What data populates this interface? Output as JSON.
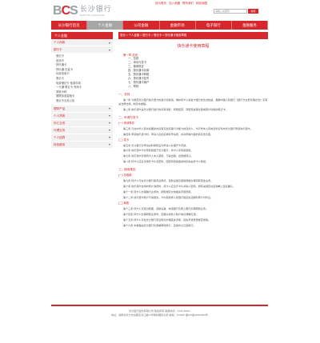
{
  "header": {
    "logo_mark": [
      "B",
      "C",
      "S"
    ],
    "logo_cn": "长沙银行",
    "logo_en": "BANK OF CHANGSHA",
    "top_links": [
      "设为首页",
      "加入收藏",
      "联系我们",
      "网站地图"
    ],
    "search_placeholder": "请输入关键字",
    "search_button": "搜索"
  },
  "nav": {
    "items": [
      "长沙银行首页",
      "个人金融",
      "公司金融",
      "金融市场",
      "电子银行",
      "金融服务"
    ],
    "active_index": 1
  },
  "sidebar": {
    "title": "个人金融",
    "groups": [
      {
        "label": "个人存款",
        "expanded": false
      },
      {
        "label": "银行卡",
        "expanded": true,
        "children": [
          "借记卡",
          "信用卡",
          "快乐通卡",
          "快乐通·白金卡",
          "标准信用卡",
          "借记卡",
          "免费借记卡·免费年费",
          "一卡通·联名卡·专用卡",
          "其他卡种",
          "银联标准金融卡",
          "借记卡业务公告"
        ]
      },
      {
        "label": "理财产品",
        "expanded": false
      },
      {
        "label": "个人贷款",
        "expanded": false
      },
      {
        "label": "外汇业务",
        "expanded": false
      },
      {
        "label": "代理业务",
        "expanded": false
      },
      {
        "label": "个人结算",
        "expanded": false
      },
      {
        "label": "特色服务",
        "expanded": false
      }
    ]
  },
  "main": {
    "breadcrumb": "首页 > 个人金融 > 银行卡 > 借记卡 > 快乐通卡使用章程",
    "doc_title": "快乐通卡使用章程",
    "toc_label": "第一章 总则",
    "toc": [
      "一、总则",
      "二、申请与发卡",
      "三、使用规定",
      "四、快乐通卡存款",
      "五、快乐通卡转账",
      "六、快乐通卡挂失",
      "七、快乐通卡销户",
      "八、附则"
    ],
    "sections": [
      {
        "title": "一、总则",
        "paragraphs": [
          "第一条 为规范长沙银行快乐通卡的发行和使用，维护持卡人和发卡银行的合法权益，根据中国人民银行《银行卡业务管理办法》及有关法律法规，制定本章程。",
          "第二条 快乐通卡是长沙银行发行的具有消费、转账结算、存取现金等全部或部分功能的借记卡。"
        ]
      },
      {
        "title": "二、申请与发卡",
        "sub": "(一) 申请条件",
        "paragraphs": [
          "第三条 凡在中华人民共和国境内具有完全民事行为能力的自然人，均可凭本人有效身份证件向长沙银行申领快乐通卡。",
          "第四条 申领快乐通卡时，申请人应如实填写申请表，并对所填内容的真实性负责。"
        ]
      },
      {
        "title": "",
        "sub": "(二) 发卡",
        "paragraphs": [
          "第五条 长沙银行对申请资料审核后为申请人办理开卡手续。",
          "第六条 快乐通卡卡片所有权属于长沙银行，持卡人享有使用权。",
          "第七条 快乐通卡仅限持卡人本人使用，不得出租、出借或转让。",
          "第八条 持卡人应妥善保管卡片及密码，因密码泄露造成的损失由持卡人承担。"
        ]
      },
      {
        "title": "三、使用规定",
        "sub": "(一) 存取款",
        "paragraphs": [
          "第九条 持卡人可在长沙银行各营业网点、自助设备及银联网络办理存取现金业务。",
          "第十条 快乐通卡在特约商户消费时，持卡人应出示卡片并输入密码，按有关规定在签购单上签名确认。",
          "第十一条 持卡人办理跨行业务时，按照规定交纳相关手续费用。",
          "第十二条 快乐通卡账户不得透支，卡内存款按人民银行规定的活期利率计付利息。"
        ]
      },
      {
        "title": "",
        "sub": "(二) 转账",
        "paragraphs": [
          "第十三条 持卡人可通过柜面、自助设备、电话银行及网上银行办理转账业务。",
          "第十四条 持卡人办理转账业务时，应确认收款人账户信息准确无误。",
          "第十五条 持卡人可在长沙银行营业网点办理挂失手续，挂失手续费按规定收取。",
          "第十六条 本章程由长沙银行负责解释和修订，自发布之日起施行。"
        ]
      }
    ]
  },
  "footer": {
    "line1": "长沙银行股份有限公司 版权所有 客服热线：0731-96511",
    "line2": "地址：湖南省长沙市岳麓区滨江路53号楷林国际大厦 邮编：410205 湘ICP备05000000号"
  },
  "colors": {
    "brand_red": "#d6282c",
    "nav_active_gray": "#a6a6a6",
    "sidebar_bg": "#f2f2f2"
  }
}
